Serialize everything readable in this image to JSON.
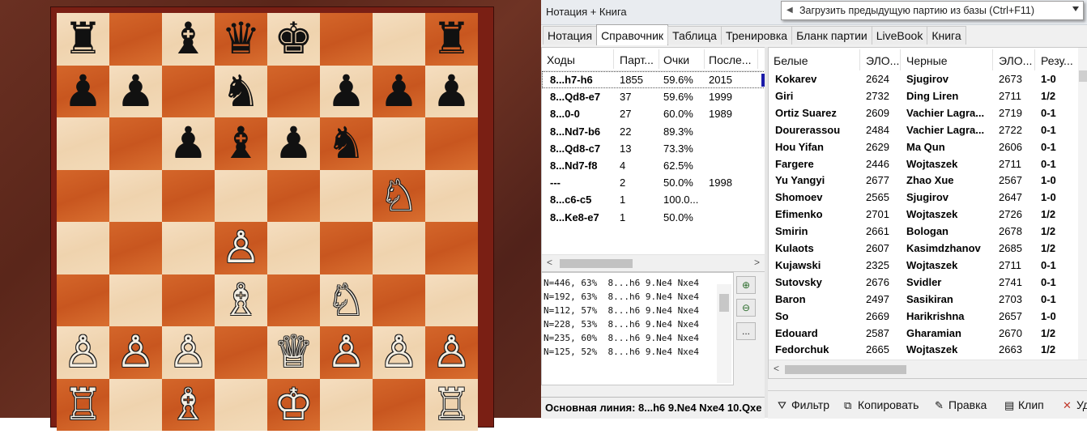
{
  "panel": {
    "title": "Нотация + Книга",
    "tooltip": "Загрузить предыдущую партию из базы (Ctrl+F11)"
  },
  "tabs": [
    "Нотация",
    "Справочник",
    "Таблица",
    "Тренировка",
    "Бланк партии",
    "LiveBook",
    "Книга"
  ],
  "active_tab": "Справочник",
  "reference": {
    "headers": [
      "Ходы",
      "Парт...",
      "Очки",
      "После..."
    ],
    "rows": [
      {
        "move": "8...h7-h6",
        "games": "1855",
        "score": "59.6%",
        "year": "2015"
      },
      {
        "move": "8...Qd8-e7",
        "games": "37",
        "score": "59.6%",
        "year": "1999"
      },
      {
        "move": "8...0-0",
        "games": "27",
        "score": "60.0%",
        "year": "1989"
      },
      {
        "move": "8...Nd7-b6",
        "games": "22",
        "score": "89.3%",
        "year": ""
      },
      {
        "move": "8...Qd8-c7",
        "games": "13",
        "score": "73.3%",
        "year": ""
      },
      {
        "move": "8...Nd7-f8",
        "games": "4",
        "score": "62.5%",
        "year": ""
      },
      {
        "move": "---",
        "games": "2",
        "score": "50.0%",
        "year": "1998"
      },
      {
        "move": "8...c6-c5",
        "games": "1",
        "score": "100.0...",
        "year": ""
      },
      {
        "move": "8...Ke8-e7",
        "games": "1",
        "score": "50.0%",
        "year": ""
      }
    ]
  },
  "lines": [
    "N=446, 63%  8...h6 9.Ne4 Nxe4",
    "N=192, 63%  8...h6 9.Ne4 Nxe4",
    "N=112, 57%  8...h6 9.Ne4 Nxe4",
    "N=228, 53%  8...h6 9.Ne4 Nxe4",
    "N=235, 60%  8...h6 9.Ne4 Nxe4",
    "N=125, 52%  8...h6 9.Ne4 Nxe4"
  ],
  "zoom_buttons": {
    "zoom_in": "⊕",
    "zoom_out": "⊖",
    "more": "..."
  },
  "mainline": "Основная линия: 8...h6 9.Ne4 Nxe4 10.Qxe",
  "games": {
    "headers": [
      "Белые",
      "ЭЛО...",
      "Черные",
      "ЭЛО...",
      "Резу..."
    ],
    "rows": [
      {
        "white": "Kokarev",
        "welo": "2624",
        "black": "Sjugirov",
        "belo": "2673",
        "result": "1-0"
      },
      {
        "white": "Giri",
        "welo": "2732",
        "black": "Ding Liren",
        "belo": "2711",
        "result": "1/2"
      },
      {
        "white": "Ortiz Suarez",
        "welo": "2609",
        "black": "Vachier Lagra...",
        "belo": "2719",
        "result": "0-1"
      },
      {
        "white": "Dourerassou",
        "welo": "2484",
        "black": "Vachier Lagra...",
        "belo": "2722",
        "result": "0-1"
      },
      {
        "white": "Hou Yifan",
        "welo": "2629",
        "black": "Ma Qun",
        "belo": "2606",
        "result": "0-1"
      },
      {
        "white": "Fargere",
        "welo": "2446",
        "black": "Wojtaszek",
        "belo": "2711",
        "result": "0-1"
      },
      {
        "white": "Yu Yangyi",
        "welo": "2677",
        "black": "Zhao Xue",
        "belo": "2567",
        "result": "1-0"
      },
      {
        "white": "Shomoev",
        "welo": "2565",
        "black": "Sjugirov",
        "belo": "2647",
        "result": "1-0"
      },
      {
        "white": "Efimenko",
        "welo": "2701",
        "black": "Wojtaszek",
        "belo": "2726",
        "result": "1/2"
      },
      {
        "white": "Smirin",
        "welo": "2661",
        "black": "Bologan",
        "belo": "2678",
        "result": "1/2"
      },
      {
        "white": "Kulaots",
        "welo": "2607",
        "black": "Kasimdzhanov",
        "belo": "2685",
        "result": "1/2"
      },
      {
        "white": "Kujawski",
        "welo": "2325",
        "black": "Wojtaszek",
        "belo": "2711",
        "result": "0-1"
      },
      {
        "white": "Sutovsky",
        "welo": "2676",
        "black": "Svidler",
        "belo": "2741",
        "result": "0-1"
      },
      {
        "white": "Baron",
        "welo": "2497",
        "black": "Sasikiran",
        "belo": "2703",
        "result": "0-1"
      },
      {
        "white": "So",
        "welo": "2669",
        "black": "Harikrishna",
        "belo": "2657",
        "result": "1-0"
      },
      {
        "white": "Edouard",
        "welo": "2587",
        "black": "Gharamian",
        "belo": "2670",
        "result": "1/2"
      },
      {
        "white": "Fedorchuk",
        "welo": "2665",
        "black": "Wojtaszek",
        "belo": "2663",
        "result": "1/2"
      }
    ]
  },
  "toolbar": [
    {
      "icon": "filter-icon",
      "glyph": "⛛",
      "label": "Фильтр"
    },
    {
      "icon": "copy-icon",
      "glyph": "⧉",
      "label": "Копировать"
    },
    {
      "icon": "edit-icon",
      "glyph": "✎",
      "label": "Правка"
    },
    {
      "icon": "clip-icon",
      "glyph": "▤",
      "label": "Клип"
    },
    {
      "icon": "delete-icon",
      "glyph": "✕",
      "label": "Уд"
    }
  ],
  "board": {
    "light_color": "#f3dbb9",
    "dark_color": "#d0602a",
    "pieces": [
      {
        "sq": "a8",
        "p": "♜",
        "side": "b"
      },
      {
        "sq": "c8",
        "p": "♝",
        "side": "b"
      },
      {
        "sq": "d8",
        "p": "♛",
        "side": "b"
      },
      {
        "sq": "e8",
        "p": "♚",
        "side": "b"
      },
      {
        "sq": "h8",
        "p": "♜",
        "side": "b"
      },
      {
        "sq": "a7",
        "p": "♟",
        "side": "b"
      },
      {
        "sq": "b7",
        "p": "♟",
        "side": "b"
      },
      {
        "sq": "d7",
        "p": "♞",
        "side": "b"
      },
      {
        "sq": "f7",
        "p": "♟",
        "side": "b"
      },
      {
        "sq": "g7",
        "p": "♟",
        "side": "b"
      },
      {
        "sq": "h7",
        "p": "♟",
        "side": "b"
      },
      {
        "sq": "c6",
        "p": "♟",
        "side": "b"
      },
      {
        "sq": "d6",
        "p": "♝",
        "side": "b"
      },
      {
        "sq": "e6",
        "p": "♟",
        "side": "b"
      },
      {
        "sq": "f6",
        "p": "♞",
        "side": "b"
      },
      {
        "sq": "g5",
        "p": "♘",
        "side": "w"
      },
      {
        "sq": "d4",
        "p": "♙",
        "side": "w"
      },
      {
        "sq": "d3",
        "p": "♗",
        "side": "w"
      },
      {
        "sq": "f3",
        "p": "♘",
        "side": "w"
      },
      {
        "sq": "a2",
        "p": "♙",
        "side": "w"
      },
      {
        "sq": "b2",
        "p": "♙",
        "side": "w"
      },
      {
        "sq": "c2",
        "p": "♙",
        "side": "w"
      },
      {
        "sq": "e2",
        "p": "♕",
        "side": "w"
      },
      {
        "sq": "f2",
        "p": "♙",
        "side": "w"
      },
      {
        "sq": "g2",
        "p": "♙",
        "side": "w"
      },
      {
        "sq": "h2",
        "p": "♙",
        "side": "w"
      },
      {
        "sq": "a1",
        "p": "♖",
        "side": "w"
      },
      {
        "sq": "c1",
        "p": "♗",
        "side": "w"
      },
      {
        "sq": "e1",
        "p": "♔",
        "side": "w"
      },
      {
        "sq": "h1",
        "p": "♖",
        "side": "w"
      }
    ]
  }
}
